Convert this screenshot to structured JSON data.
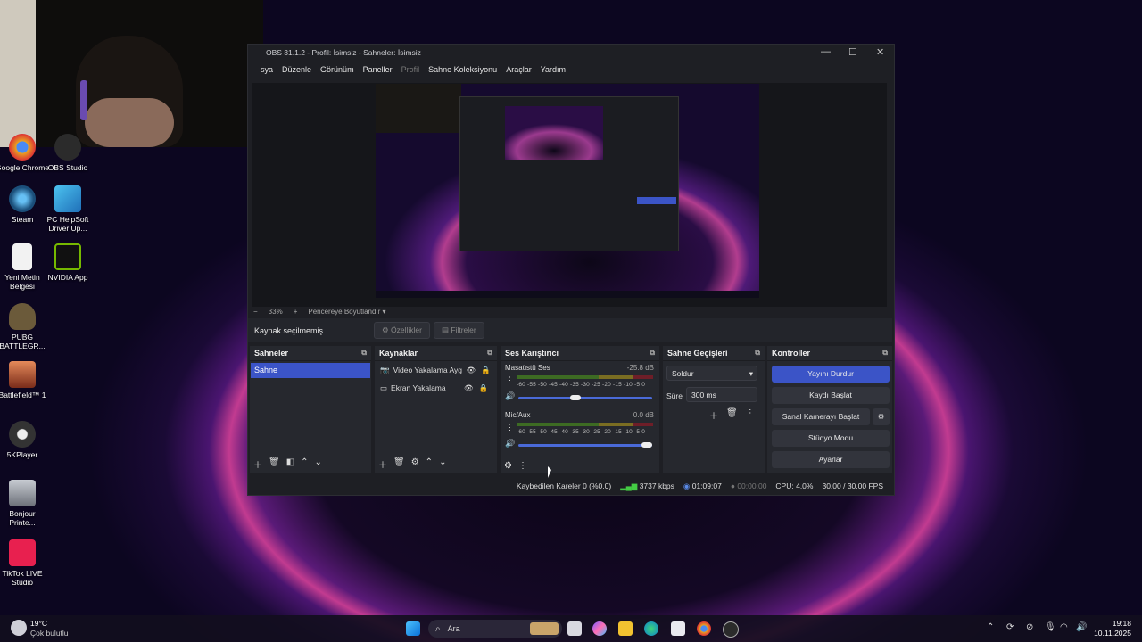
{
  "desktop": {
    "icons": [
      {
        "label": "Google Chrome",
        "color": "#e8a323"
      },
      {
        "label": "OBS Studio",
        "color": "#2b2b2b"
      },
      {
        "label": "Steam",
        "color": "#1b4f7a"
      },
      {
        "label": "PC HelpSoft Driver Up...",
        "color": "#2f8bd0"
      },
      {
        "label": "Yeni Metin Belgesi",
        "color": "#f2f2f2"
      },
      {
        "label": "NVIDIA App",
        "color": "#76b900"
      },
      {
        "label": "PUBG BATTLEGR...",
        "color": "#6b5a3a"
      },
      {
        "label": "Battlefield™ 1",
        "color": "#c4522b"
      },
      {
        "label": "5KPlayer",
        "color": "#333333"
      },
      {
        "label": "Bonjour Printe...",
        "color": "#9aa0a8"
      },
      {
        "label": "TikTok LIVE Studio",
        "color": "#e8204f"
      }
    ]
  },
  "obs": {
    "title": "OBS 31.1.2 - Profil: İsimsiz - Sahneler: İsimsiz",
    "menu": [
      "sya",
      "Düzenle",
      "Görünüm",
      "Paneller",
      "Profil",
      "Sahne Koleksiyonu",
      "Araçlar",
      "Yardım"
    ],
    "zoom": {
      "minus": "−",
      "value": "33%",
      "plus": "+",
      "fit": "Pencereye Boyutlandır"
    },
    "source_bar": {
      "status": "Kaynak seçilmemiş",
      "properties": "Özellikler",
      "filters": "Filtreler"
    },
    "scenes": {
      "header": "Sahneler",
      "items": [
        "Sahne"
      ]
    },
    "sources": {
      "header": "Kaynaklar",
      "items": [
        "Video Yakalama Ayg",
        "Ekran Yakalama"
      ]
    },
    "mixer": {
      "header": "Ses Karıştırıcı",
      "channels": [
        {
          "name": "Masaüstü Ses",
          "db": "-25.8 dB",
          "level": 0.42
        },
        {
          "name": "Mic/Aux",
          "db": "0.0 dB",
          "level": 1.0
        }
      ],
      "ticks": "-60 -55 -50 -45 -40 -35 -30 -25 -20 -15 -10 -5 0"
    },
    "transitions": {
      "header": "Sahne Geçişleri",
      "selected": "Soldur",
      "duration_label": "Süre",
      "duration_value": "300 ms"
    },
    "controls": {
      "header": "Kontroller",
      "buttons": [
        "Yayını Durdur",
        "Kaydı Başlat",
        "Sanal Kamerayı Başlat",
        "Stüdyo Modu",
        "Ayarlar"
      ],
      "accent": "#3b54c7"
    },
    "status": {
      "dropped": "Kaybedilen Kareler 0 (%0.0)",
      "bitrate": "3737 kbps",
      "stream_time": "01:09:07",
      "rec_time": "00:00:00",
      "cpu": "CPU: 4.0%",
      "fps": "30.00 / 30.00 FPS"
    }
  },
  "taskbar": {
    "weather_temp": "19°C",
    "weather_desc": "Çok bulutlu",
    "search": "Ara",
    "time": "19:18",
    "date": "10.11.2025"
  }
}
